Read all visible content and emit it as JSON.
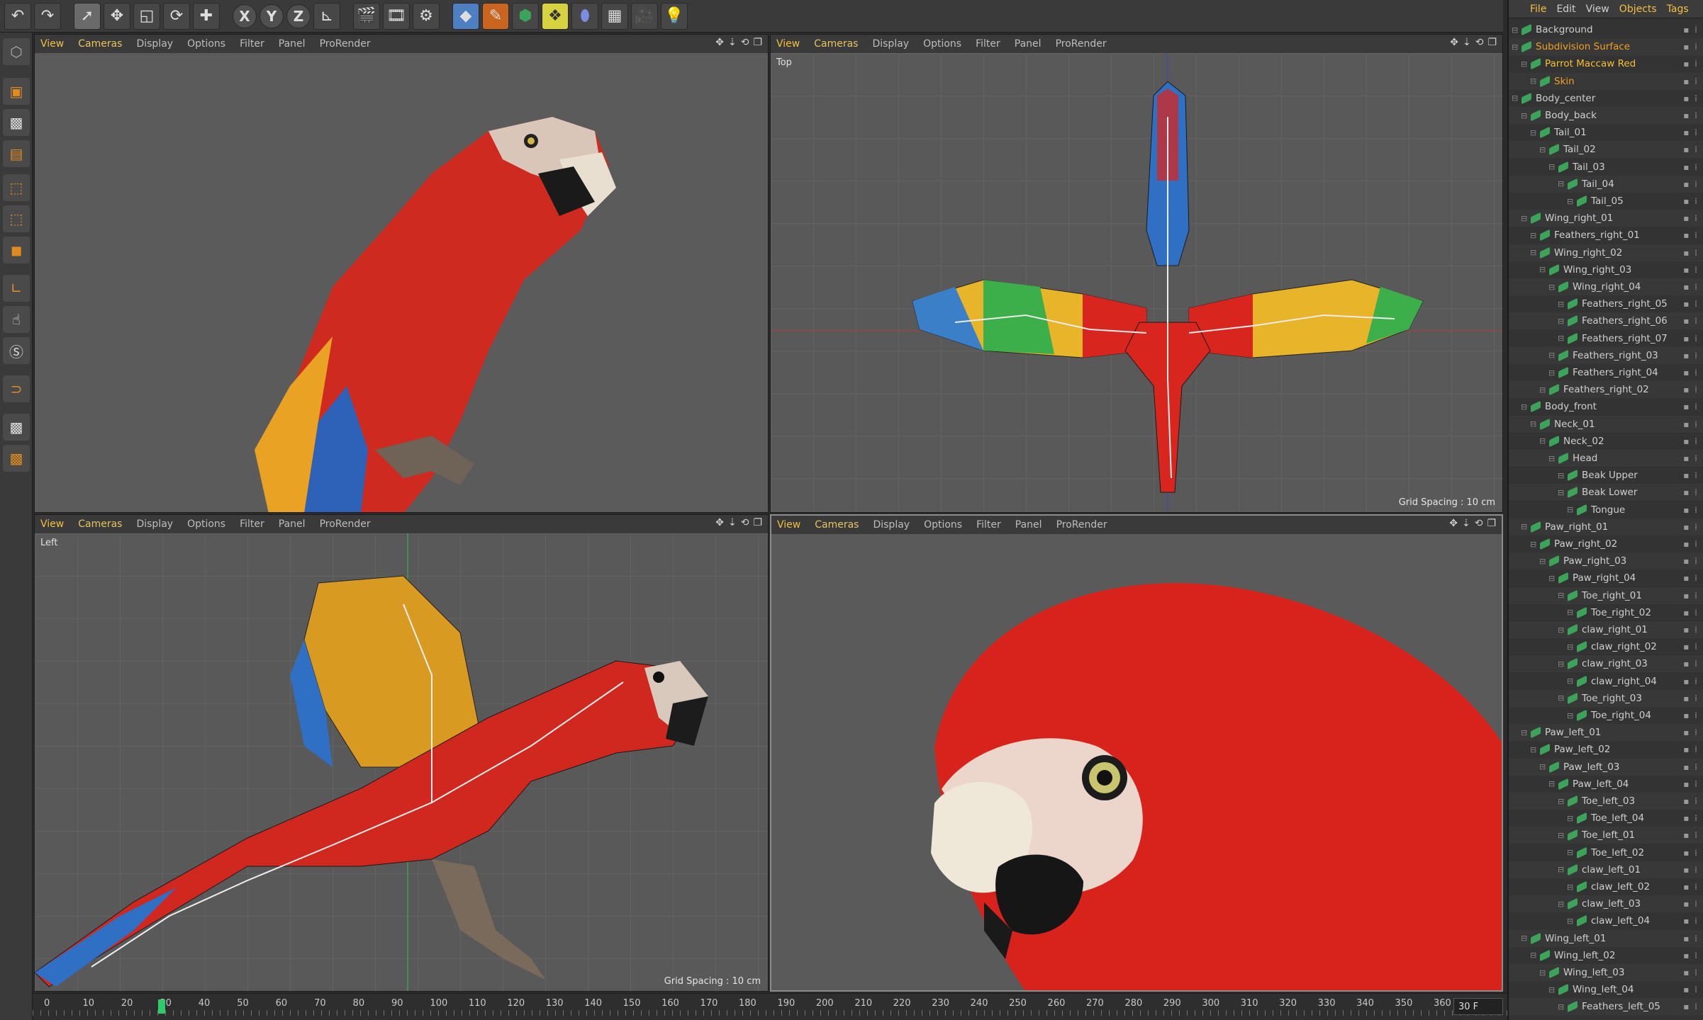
{
  "toolbar": {
    "icons": [
      "undo-icon",
      "redo-icon",
      "select-icon",
      "move-icon",
      "scale-icon",
      "rotate-icon",
      "add-icon",
      "x-axis-icon",
      "y-axis-icon",
      "z-axis-icon",
      "coordinate-system-icon",
      "render-view-icon",
      "render-picture-viewer-icon",
      "render-settings-icon",
      "cube-icon",
      "pen-icon",
      "subdivision-icon",
      "array-icon",
      "deformer-icon",
      "floor-icon",
      "camera-icon",
      "light-icon"
    ],
    "axis_x": "X",
    "axis_y": "Y",
    "axis_z": "Z"
  },
  "viewport_menu": [
    "View",
    "Cameras",
    "Display",
    "Options",
    "Filter",
    "Panel",
    "ProRender"
  ],
  "viewports": {
    "perspective": {
      "name": ""
    },
    "top": {
      "name": "Top",
      "grid_spacing": "Grid Spacing : 10 cm"
    },
    "left": {
      "name": "Left",
      "grid_spacing": "Grid Spacing : 10 cm"
    },
    "front": {
      "name": ""
    }
  },
  "object_manager": {
    "menu": [
      "File",
      "Edit",
      "View",
      "Objects",
      "Tags"
    ],
    "items": [
      {
        "label": "Background",
        "indent": 0
      },
      {
        "label": "Subdivision Surface",
        "indent": 0,
        "color": "orange"
      },
      {
        "label": "Parrot Maccaw Red",
        "indent": 1,
        "color": "yellow"
      },
      {
        "label": "Skin",
        "indent": 2,
        "color": "orange"
      },
      {
        "label": "Body_center",
        "indent": 0
      },
      {
        "label": "Body_back",
        "indent": 1
      },
      {
        "label": "Tail_01",
        "indent": 2
      },
      {
        "label": "Tail_02",
        "indent": 3
      },
      {
        "label": "Tail_03",
        "indent": 4
      },
      {
        "label": "Tail_04",
        "indent": 5
      },
      {
        "label": "Tail_05",
        "indent": 6
      },
      {
        "label": "Wing_right_01",
        "indent": 1
      },
      {
        "label": "Feathers_right_01",
        "indent": 2
      },
      {
        "label": "Wing_right_02",
        "indent": 2
      },
      {
        "label": "Wing_right_03",
        "indent": 3
      },
      {
        "label": "Wing_right_04",
        "indent": 4
      },
      {
        "label": "Feathers_right_05",
        "indent": 5
      },
      {
        "label": "Feathers_right_06",
        "indent": 5
      },
      {
        "label": "Feathers_right_07",
        "indent": 5
      },
      {
        "label": "Feathers_right_03",
        "indent": 4
      },
      {
        "label": "Feathers_right_04",
        "indent": 4
      },
      {
        "label": "Feathers_right_02",
        "indent": 3
      },
      {
        "label": "Body_front",
        "indent": 1
      },
      {
        "label": "Neck_01",
        "indent": 2
      },
      {
        "label": "Neck_02",
        "indent": 3
      },
      {
        "label": "Head",
        "indent": 4
      },
      {
        "label": "Beak Upper",
        "indent": 5
      },
      {
        "label": "Beak Lower",
        "indent": 5
      },
      {
        "label": "Tongue",
        "indent": 6
      },
      {
        "label": "Paw_right_01",
        "indent": 1
      },
      {
        "label": "Paw_right_02",
        "indent": 2
      },
      {
        "label": "Paw_right_03",
        "indent": 3
      },
      {
        "label": "Paw_right_04",
        "indent": 4
      },
      {
        "label": "Toe_right_01",
        "indent": 5
      },
      {
        "label": "Toe_right_02",
        "indent": 6
      },
      {
        "label": "claw_right_01",
        "indent": 5
      },
      {
        "label": "claw_right_02",
        "indent": 6
      },
      {
        "label": "claw_right_03",
        "indent": 5
      },
      {
        "label": "claw_right_04",
        "indent": 6
      },
      {
        "label": "Toe_right_03",
        "indent": 5
      },
      {
        "label": "Toe_right_04",
        "indent": 6
      },
      {
        "label": "Paw_left_01",
        "indent": 1
      },
      {
        "label": "Paw_left_02",
        "indent": 2
      },
      {
        "label": "Paw_left_03",
        "indent": 3
      },
      {
        "label": "Paw_left_04",
        "indent": 4
      },
      {
        "label": "Toe_left_03",
        "indent": 5
      },
      {
        "label": "Toe_left_04",
        "indent": 6
      },
      {
        "label": "Toe_left_01",
        "indent": 5
      },
      {
        "label": "Toe_left_02",
        "indent": 6
      },
      {
        "label": "claw_left_01",
        "indent": 5
      },
      {
        "label": "claw_left_02",
        "indent": 6
      },
      {
        "label": "claw_left_03",
        "indent": 5
      },
      {
        "label": "claw_left_04",
        "indent": 6
      },
      {
        "label": "Wing_left_01",
        "indent": 1
      },
      {
        "label": "Wing_left_02",
        "indent": 2
      },
      {
        "label": "Wing_left_03",
        "indent": 3
      },
      {
        "label": "Wing_left_04",
        "indent": 4
      },
      {
        "label": "Feathers_left_05",
        "indent": 5
      }
    ]
  },
  "timeline": {
    "ticks": [
      "0",
      "10",
      "20",
      "30",
      "40",
      "50",
      "60",
      "70",
      "80",
      "90",
      "100",
      "110",
      "120",
      "130",
      "140",
      "150",
      "160",
      "170",
      "180",
      "190",
      "200",
      "210",
      "220",
      "230",
      "240",
      "250",
      "260",
      "270",
      "280",
      "290",
      "300",
      "310",
      "320",
      "330",
      "340",
      "350",
      "360"
    ],
    "current_frame": 30,
    "frame_field": "30 F"
  },
  "colors": {
    "accent": "#f0c040",
    "parrot_red": "#d8261f",
    "wing_blue": "#2f6fc4",
    "wing_yellow": "#e8b42a",
    "wing_green": "#3cae4a"
  }
}
